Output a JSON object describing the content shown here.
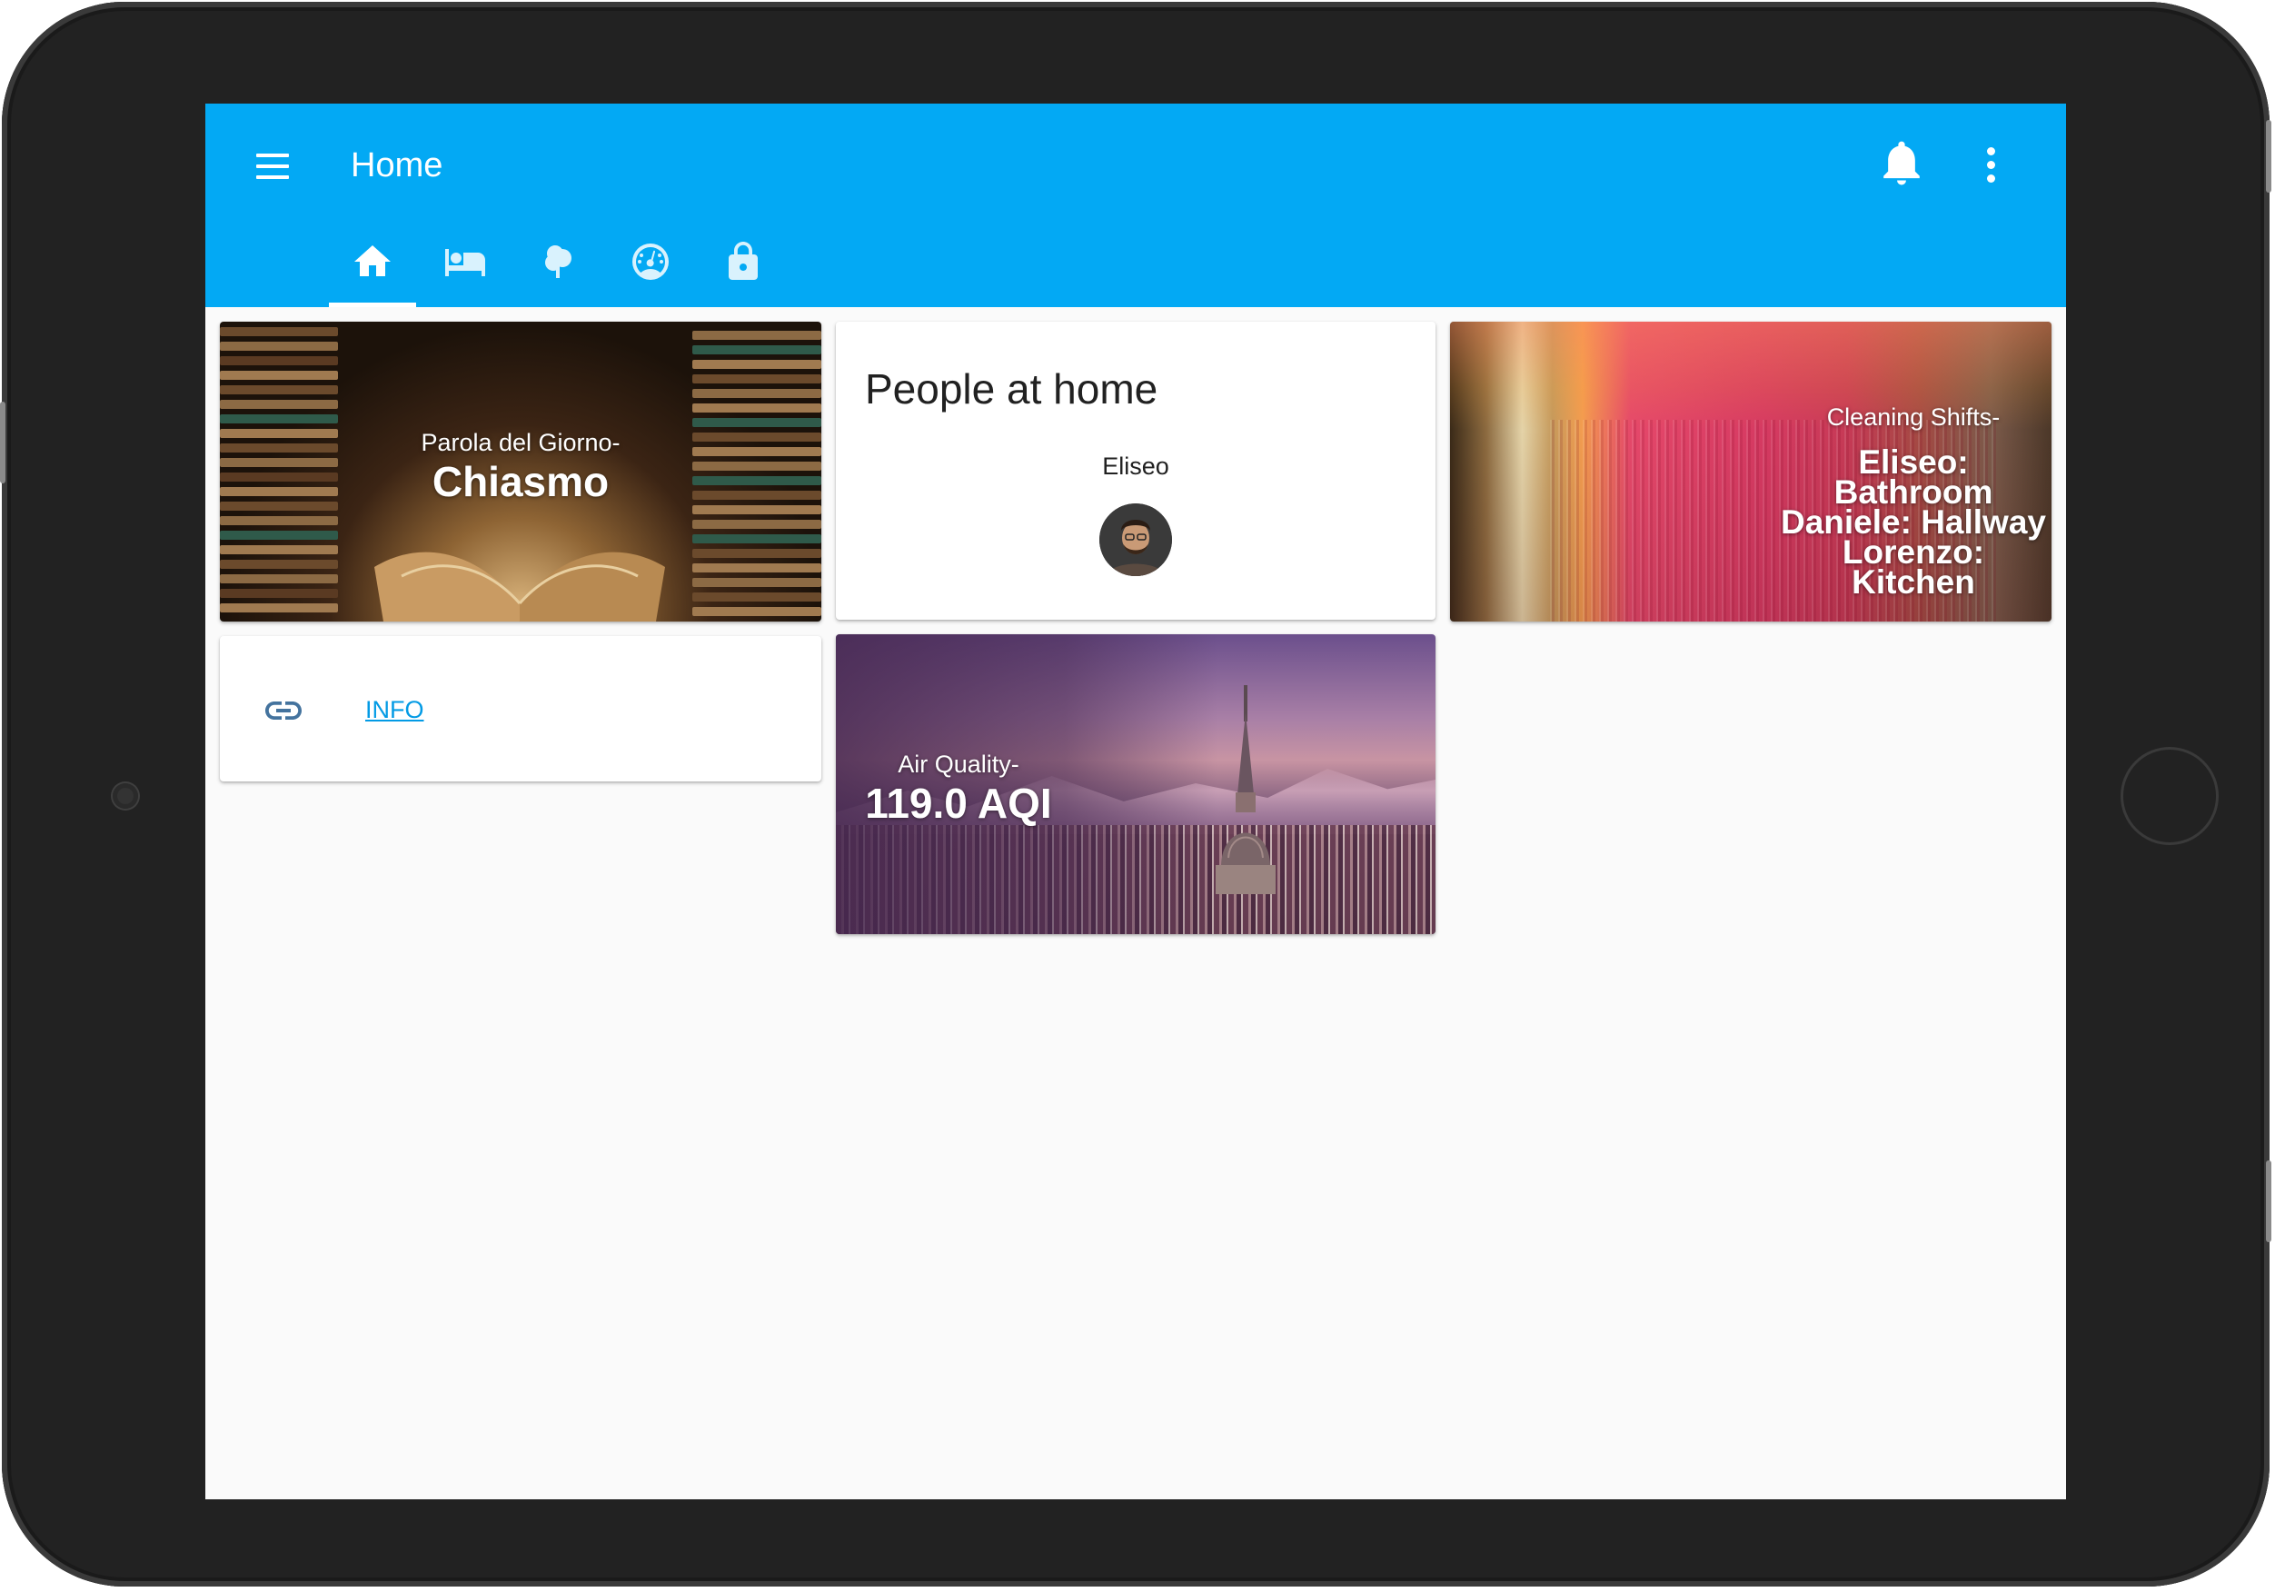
{
  "app": {
    "title": "Home"
  },
  "cards": {
    "word": {
      "subtitle": "Parola del Giorno-",
      "title": "Chiasmo"
    },
    "people": {
      "title": "People at home",
      "persons": [
        {
          "name": "Eliseo"
        }
      ]
    },
    "cleaning": {
      "subtitle": "Cleaning Shifts-",
      "lines": [
        "Eliseo: Bathroom",
        "Daniele: Hallway",
        "Lorenzo: Kitchen"
      ]
    },
    "link": {
      "label": "INFO",
      "icon": "link-icon"
    },
    "air": {
      "subtitle": "Air Quality-",
      "value": "119.0 AQI"
    }
  },
  "tabs": [
    {
      "icon": "home-icon",
      "active": true
    },
    {
      "icon": "bed-icon",
      "active": false
    },
    {
      "icon": "tree-icon",
      "active": false
    },
    {
      "icon": "speedometer-icon",
      "active": false
    },
    {
      "icon": "lock-icon",
      "active": false
    }
  ],
  "colors": {
    "primary": "#03a9f4",
    "link": "#039be5",
    "background": "#fafafa"
  }
}
